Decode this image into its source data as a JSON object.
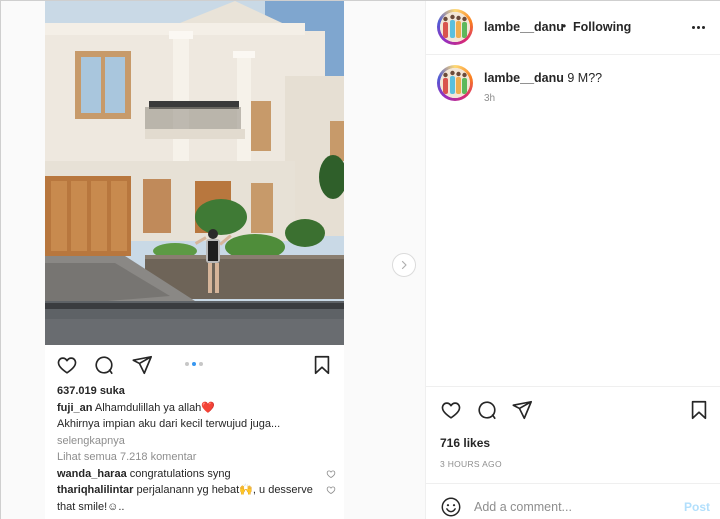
{
  "header": {
    "username": "lambe__danu",
    "separator": "•",
    "follow_status": "Following",
    "more_icon": "more-horizontal-icon"
  },
  "caption": {
    "username": "lambe__danu",
    "text": "9 M??",
    "time": "3h"
  },
  "embedded": {
    "likes": "637.019 suka",
    "caption_user": "fuji_an",
    "caption_text": "Alhamdulillah ya allah",
    "caption_emoji": "❤️",
    "caption_line2": "Akhirnya impian aku dari kecil terwujud juga...",
    "more_label": "selengkapnya",
    "view_all": "Lihat semua 7.218 komentar",
    "comments": [
      {
        "user": "wanda_haraa",
        "text": "congratulations syng"
      },
      {
        "user": "thariqhalilintar",
        "text": "perjalanann yg hebat🙌, u desserve that smile!☺.."
      }
    ],
    "carousel_index": 2,
    "carousel_total": 3
  },
  "actions": {
    "likes": "716 likes",
    "timestamp": "3 HOURS AGO"
  },
  "comment_box": {
    "placeholder": "Add a comment...",
    "post_label": "Post"
  },
  "colors": {
    "accent": "#3897f0",
    "post_disabled": "#b2dffc",
    "muted": "#8e8e8e",
    "like_red": "#ed4956"
  }
}
